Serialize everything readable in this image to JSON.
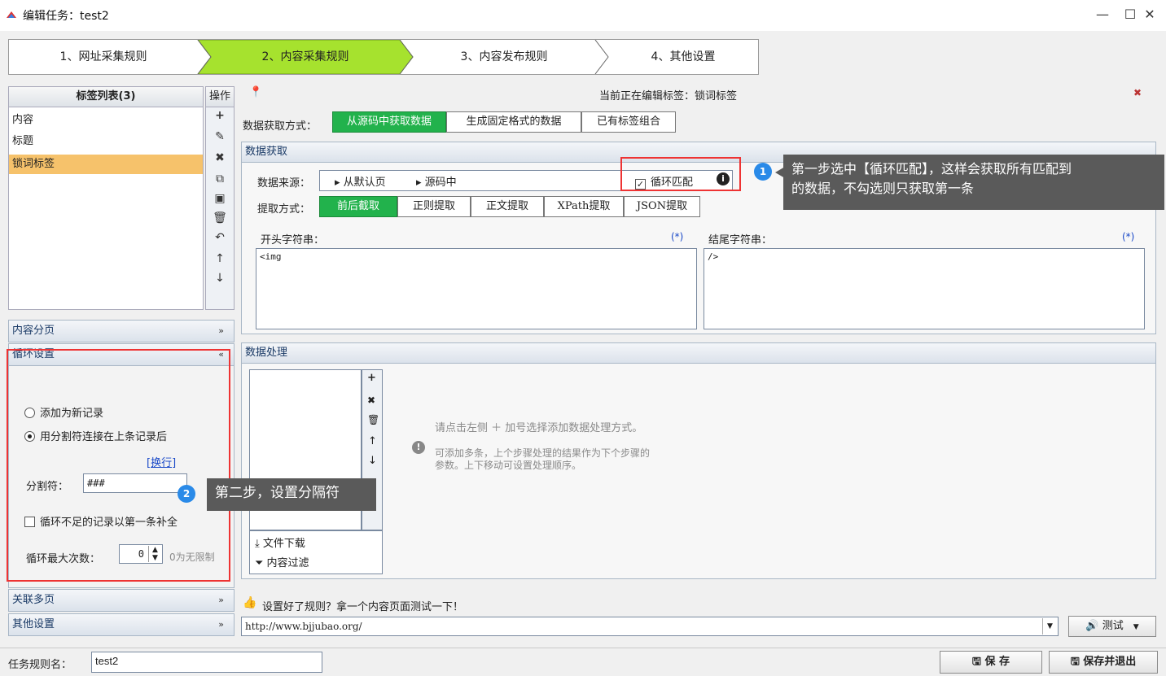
{
  "window": {
    "title": "编辑任务：test2",
    "minimize": "—",
    "maximize": "☐",
    "close": "✕"
  },
  "wizard": {
    "steps": [
      "1、网址采集规则",
      "2、内容采集规则",
      "3、内容发布规则",
      "4、其他设置"
    ],
    "active_index": 1,
    "active_color": "#a6e22e"
  },
  "tag_list": {
    "header": "标签列表(3)",
    "ops_header": "操作",
    "items": [
      "内容",
      "标题",
      "锁词标签"
    ],
    "selected_index": 2,
    "selected_color": "#f6c26b",
    "op_icons": [
      "plus-icon",
      "pencil-icon",
      "delete-icon",
      "copy-icon",
      "paste-icon",
      "trash-icon",
      "undo-icon",
      "arrow-up-icon",
      "arrow-down-icon"
    ]
  },
  "accordion": {
    "content_paging": "内容分页",
    "loop_settings": "循环设置",
    "related_pages": "关联多页",
    "other_settings": "其他设置"
  },
  "loop": {
    "option_new": "添加为新记录",
    "option_join": "用分割符连接在上条记录后",
    "newline_link": "[换行]",
    "separator_label": "分割符：",
    "separator_value": "###",
    "fill_label": "循环不足的记录以第一条补全",
    "max_label": "循环最大次数：",
    "max_value": "0",
    "max_hint": "0为无限制"
  },
  "editor": {
    "pin": "📍",
    "editing_label": "当前正在编辑标签：锁词标签",
    "close": "✖",
    "mode_label": "数据获取方式：",
    "modes": [
      "从源码中获取数据",
      "生成固定格式的数据",
      "已有标签组合"
    ],
    "active_mode": 0
  },
  "fetch": {
    "section_title": "数据获取",
    "source_label": "数据来源：",
    "source_parts": [
      "▸ 从默认页",
      "▸ 源码中"
    ],
    "loop_match": "循环匹配",
    "method_label": "提取方式：",
    "methods": [
      "前后截取",
      "正则提取",
      "正文提取",
      "XPath提取",
      "JSON提取"
    ],
    "active_method": 0,
    "start_label": "开头字符串：",
    "end_label": "结尾字符串：",
    "star": "(*)",
    "start_value": "<img",
    "end_value": "/>"
  },
  "process": {
    "section_title": "数据处理",
    "hint_line1": "请点击左侧 ＋ 加号选择添加数据处理方式。",
    "hint_line2": "可添加多条，上个步骤处理的结果作为下个步骤的",
    "hint_line3": "参数。上下移动可设置处理顺序。",
    "file_download": "文件下载",
    "content_filter": "内容过滤"
  },
  "test": {
    "prompt": "设置好了规则？拿一个内容页面测试一下！",
    "url": "http://www.bjjubao.org/",
    "test_button": "测试"
  },
  "footer": {
    "rule_name_label": "任务规则名：",
    "rule_name_value": "test2",
    "save": "保 存",
    "save_exit": "保存并退出"
  },
  "tooltips": {
    "step1_badge": "1",
    "step1_line1": "第一步选中【循环匹配】，这样会获取所有匹配到",
    "step1_line2": "的数据，不勾选则只获取第一条",
    "step2_badge": "2",
    "step2_text": "第二步，设置分隔符"
  }
}
